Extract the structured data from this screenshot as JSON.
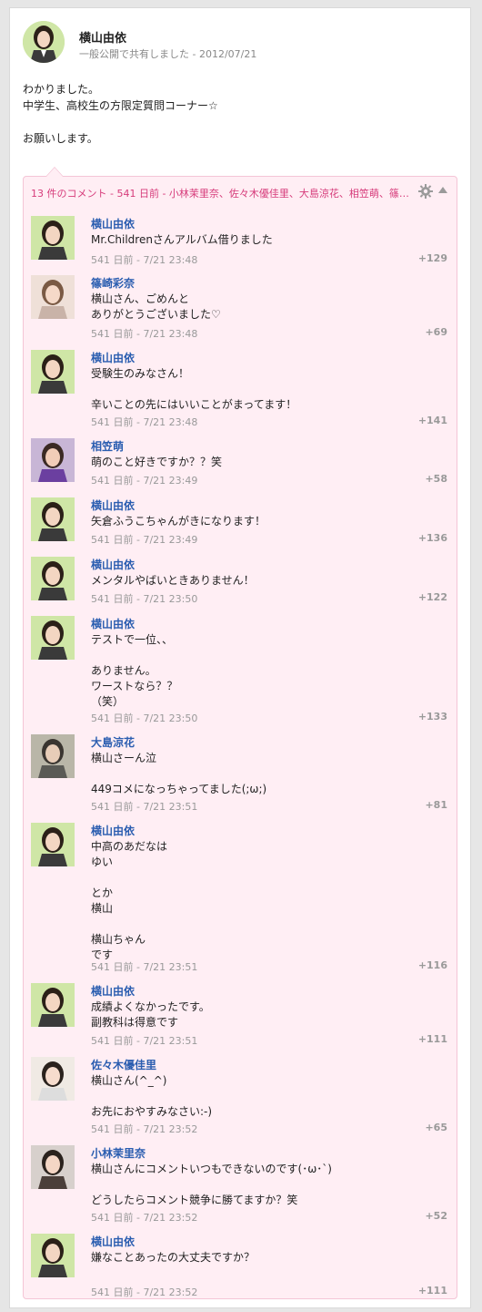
{
  "post": {
    "author": "横山由依",
    "meta": "一般公開で共有しました  -  2012/07/21",
    "body": "わかりました。\n中学生、高校生の方限定質問コーナー☆\n\nお願いします。"
  },
  "comments_header": {
    "summary": "13 件のコメント - 541 日前 - 小林茉里奈、佐々木優佳里、大島涼花、相笠萌、篠…"
  },
  "comments": [
    {
      "name": "横山由依",
      "text": "Mr.Childrenさんアルバム借りました",
      "time": "541 日前 - 7/21 23:48",
      "plus": "+129",
      "avatar": "yui"
    },
    {
      "name": "篠崎彩奈",
      "text": "横山さん、ごめんと\nありがとうございました♡",
      "time": "541 日前 - 7/21 23:48",
      "plus": "+69",
      "avatar": "ayana"
    },
    {
      "name": "横山由依",
      "text": "受験生のみなさん！\n\n辛いことの先にはいいことがまってます！",
      "time": "541 日前 - 7/21 23:48",
      "plus": "+141",
      "avatar": "yui"
    },
    {
      "name": "相笠萌",
      "text": "萌のこと好きですか？？笑",
      "time": "541 日前 - 7/21 23:49",
      "plus": "+58",
      "avatar": "moe"
    },
    {
      "name": "横山由依",
      "text": "矢倉ふうこちゃんがきになります！",
      "time": "541 日前 - 7/21 23:49",
      "plus": "+136",
      "avatar": "yui"
    },
    {
      "name": "横山由依",
      "text": "メンタルやばいときありません！",
      "time": "541 日前 - 7/21 23:50",
      "plus": "+122",
      "avatar": "yui"
    },
    {
      "name": "横山由依",
      "text": "テストで一位、、\n\nありません。\nワーストなら？？\n（笑）",
      "time": "541 日前 - 7/21 23:50",
      "plus": "+133",
      "avatar": "yui"
    },
    {
      "name": "大島涼花",
      "text": "横山さーん泣\n\n449コメになっちゃってました(;ω;)",
      "time": "541 日前 - 7/21 23:51",
      "plus": "+81",
      "avatar": "ryoka"
    },
    {
      "name": "横山由依",
      "text": "中高のあだなは\nゆい\n\nとか\n横山\n\n横山ちゃん\nです",
      "time": "541 日前 - 7/21 23:51",
      "plus": "+116",
      "avatar": "yui"
    },
    {
      "name": "横山由依",
      "text": "成績よくなかったです。\n副教科は得意です",
      "time": "541 日前 - 7/21 23:51",
      "plus": "+111",
      "avatar": "yui"
    },
    {
      "name": "佐々木優佳里",
      "text": "横山さん(^_^)\n\nお先におやすみなさい:-)",
      "time": "541 日前 - 7/21 23:52",
      "plus": "+65",
      "avatar": "yukari"
    },
    {
      "name": "小林茉里奈",
      "text": "横山さんにコメントいつもできないのです(･ω･`)\n\nどうしたらコメント競争に勝てますか？笑",
      "time": "541 日前 - 7/21 23:52",
      "plus": "+52",
      "avatar": "marina"
    },
    {
      "name": "横山由依",
      "text": "嫌なことあったの大丈夫ですか？",
      "time": "541 日前 - 7/21 23:52",
      "plus": "+111",
      "avatar": "yui"
    }
  ],
  "colors": {
    "accent": "#d63b7a",
    "link": "#2a5db0",
    "comments_bg": "#ffeef4"
  },
  "icons": [
    "gear-icon",
    "collapse-arrow-icon"
  ]
}
